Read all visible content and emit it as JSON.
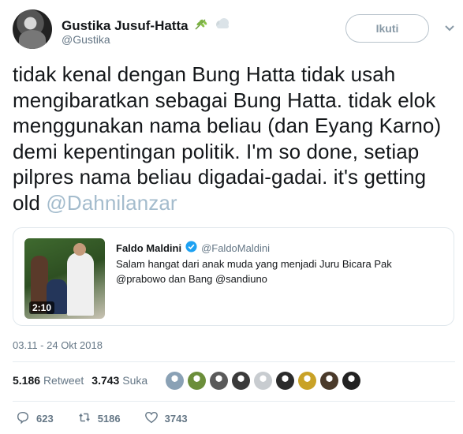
{
  "user": {
    "display_name": "Gustika Jusuf-Hatta",
    "handle": "@Gustika",
    "badges": [
      "herb-emoji",
      "cloud-emoji"
    ]
  },
  "follow_button": {
    "label": "Ikuti"
  },
  "tweet": {
    "text_plain": "tidak kenal dengan Bung Hatta tidak usah mengibaratkan sebagai Bung Hatta. tidak elok menggunakan nama beliau (dan Eyang Karno) demi kepentingan politik. I'm so done, setiap pilpres nama beliau digadai-gadai. it's getting old ",
    "mention": "@Dahnilanzar"
  },
  "quoted_tweet": {
    "display_name": "Faldo Maldini",
    "verified": true,
    "handle": "@FaldoMaldini",
    "text": "Salam hangat dari anak muda yang menjadi Juru Bicara Pak @prabowo dan Bang @sandiuno",
    "video_duration": "2:10"
  },
  "timestamp": "03.11 - 24 Okt 2018",
  "stats": {
    "retweets_count": "5.186",
    "retweets_label": "Retweet",
    "likes_count": "3.743",
    "likes_label": "Suka"
  },
  "liker_avatars": [
    "#8aa1b5",
    "#6b8e3a",
    "#5a5a5a",
    "#3b3b3b",
    "#c8ccd0",
    "#2b2b2b",
    "#c9a227",
    "#4a3a2a",
    "#222222"
  ],
  "actions": {
    "reply_count": "623",
    "retweet_count": "5186",
    "like_count": "3743"
  },
  "colors": {
    "verified_blue": "#1da1f2",
    "mention": "#a4bccd",
    "muted": "#657786"
  }
}
